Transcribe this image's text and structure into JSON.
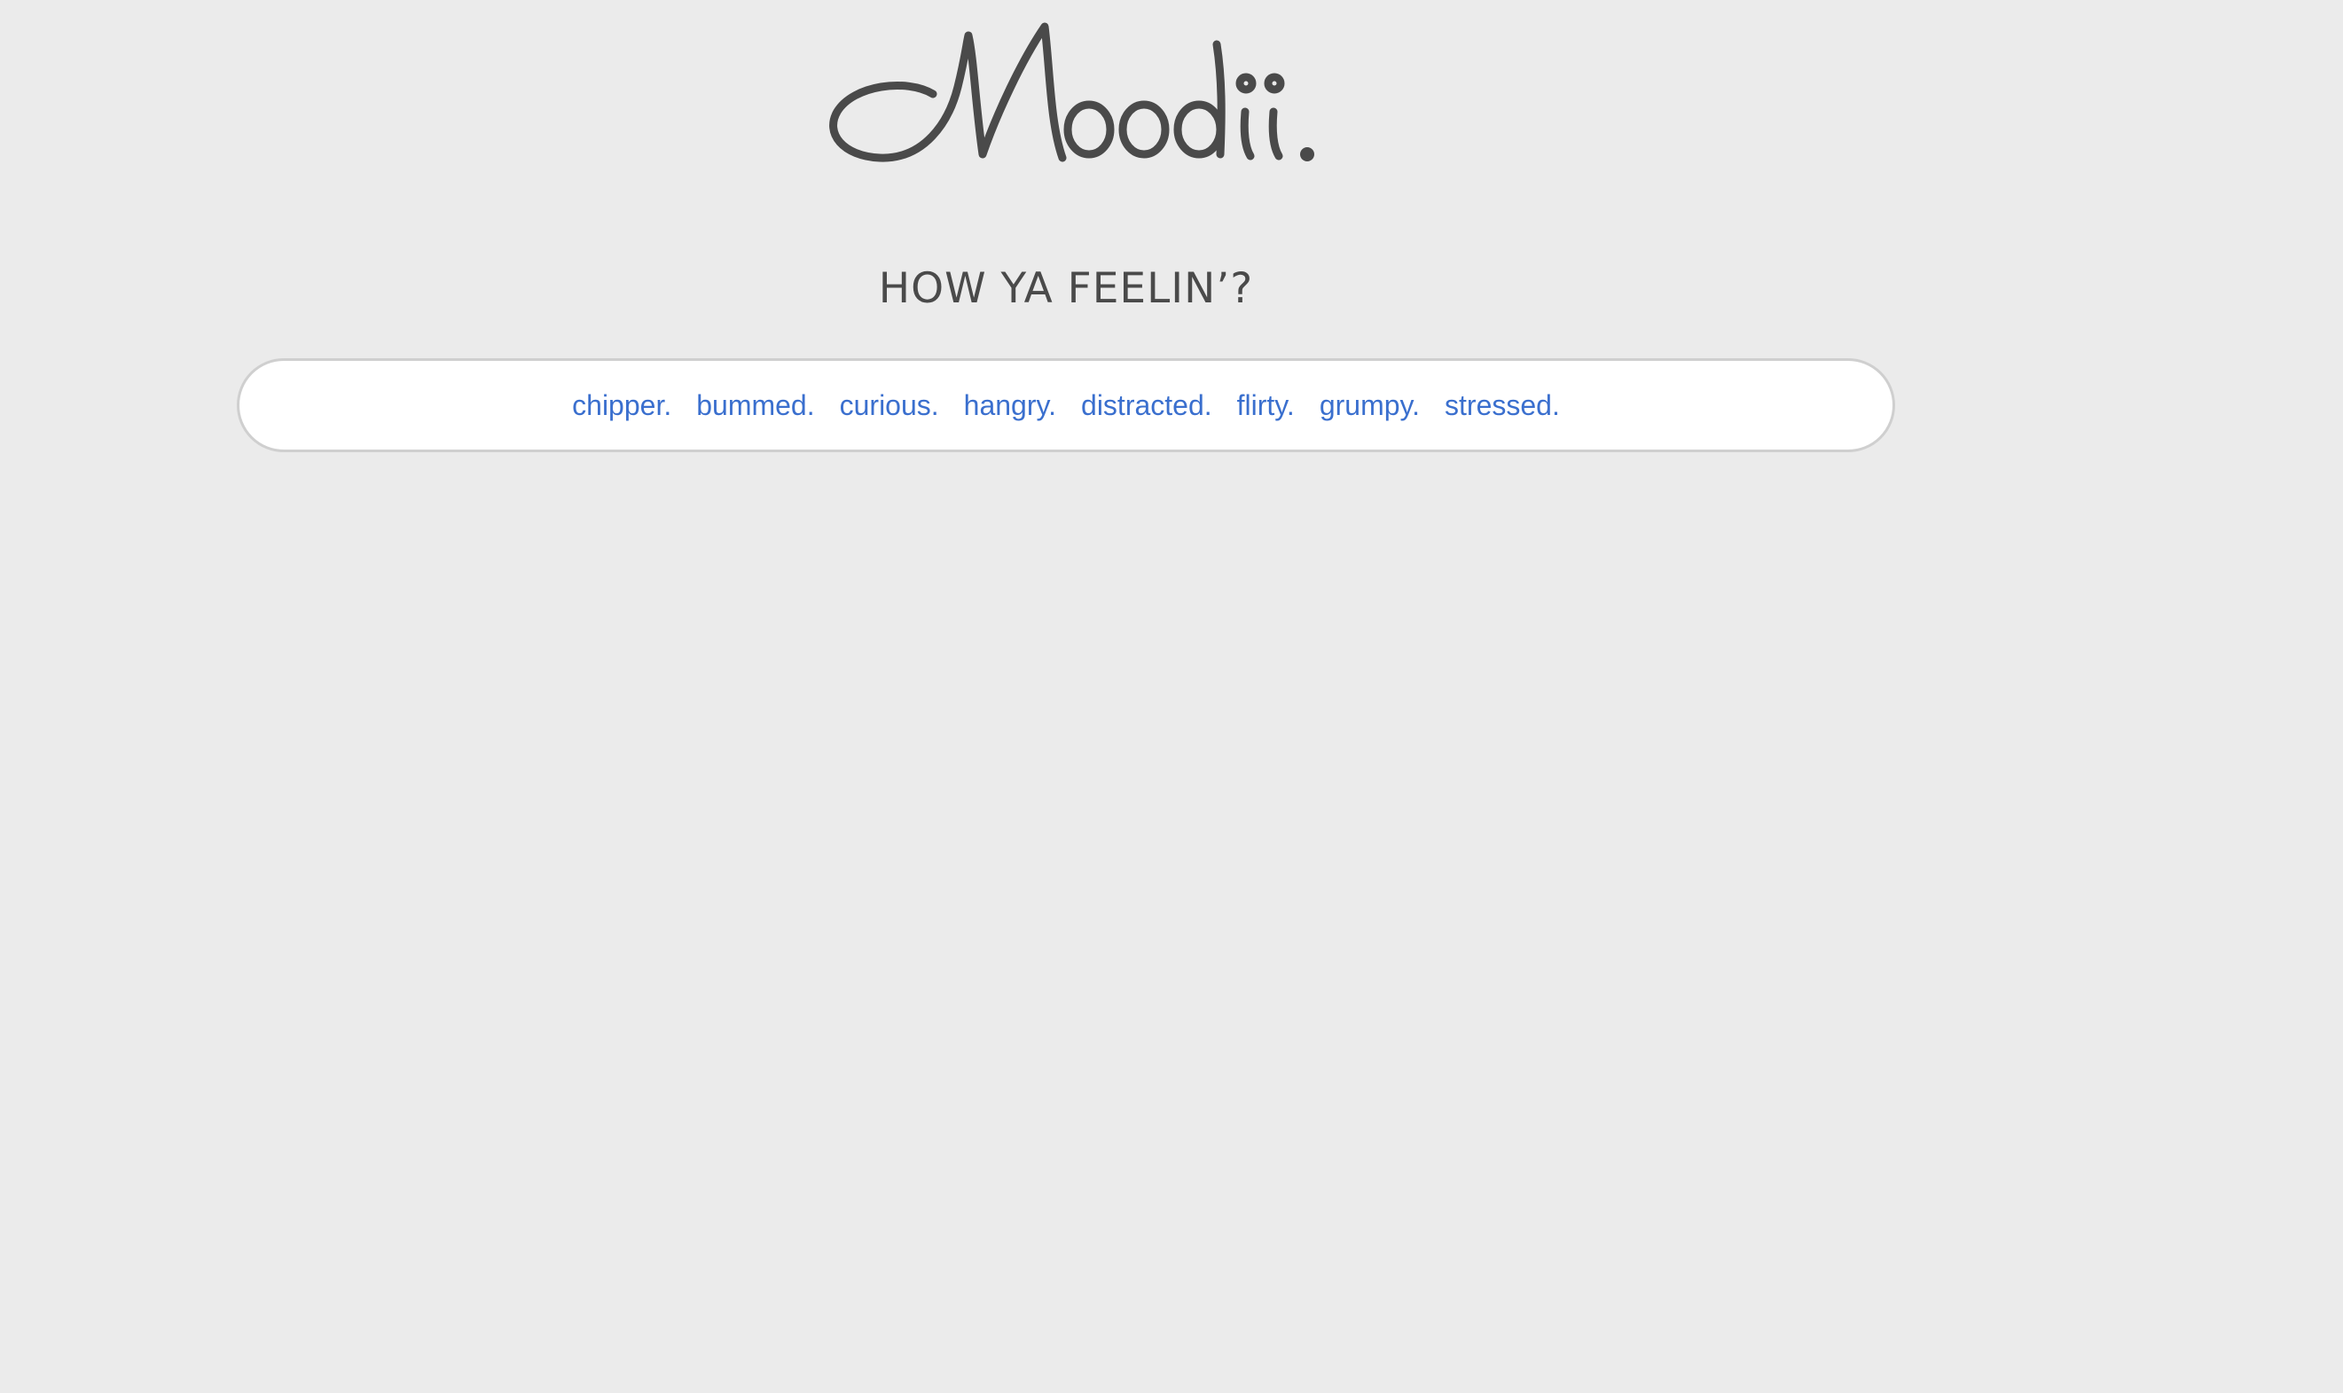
{
  "brand": {
    "logo_text": "Moodii.",
    "text_color": "#4a4a4a"
  },
  "prompt": {
    "heading": "HOW YA FEELIN’?"
  },
  "moods": [
    {
      "label": "chipper."
    },
    {
      "label": "bummed."
    },
    {
      "label": "curious."
    },
    {
      "label": "hangry."
    },
    {
      "label": "distracted."
    },
    {
      "label": "flirty."
    },
    {
      "label": "grumpy."
    },
    {
      "label": "stressed."
    }
  ],
  "colors": {
    "background": "#ebebeb",
    "link": "#3a6fce",
    "bar_background": "#ffffff",
    "bar_border": "#cfcfcf"
  }
}
